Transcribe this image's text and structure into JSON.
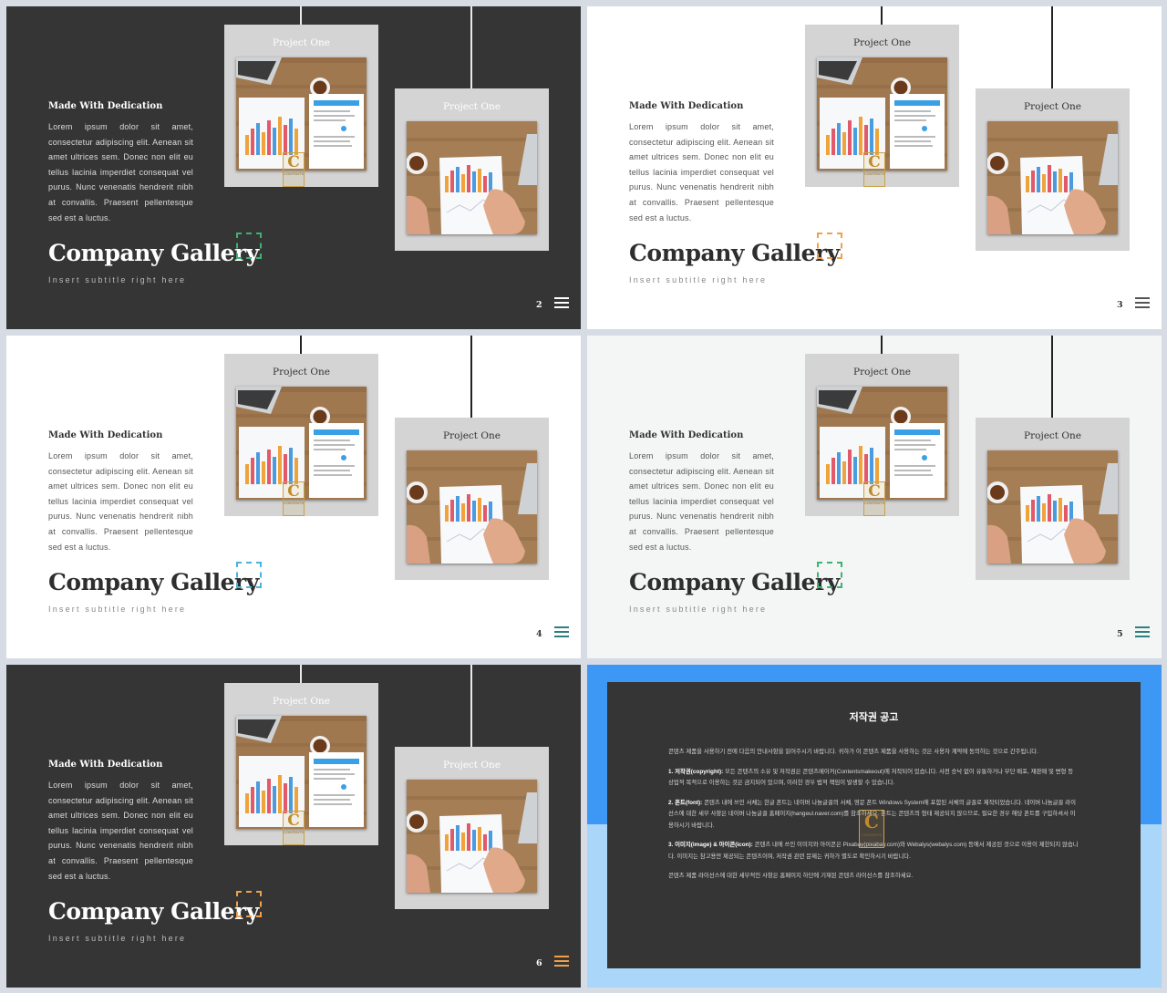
{
  "slides": [
    {
      "number": "2",
      "theme": "dark",
      "background": "#353535",
      "accent": "#3cb371",
      "menu_color": "#ffffff",
      "card_title_color": "#ffffff"
    },
    {
      "number": "3",
      "theme": "light",
      "background": "#ffffff",
      "accent": "#f0a04b",
      "menu_color": "#555555",
      "card_title_color": "#333333"
    },
    {
      "number": "4",
      "theme": "light",
      "background": "#ffffff",
      "accent": "#4ab3d9",
      "menu_color": "#2e7f7f",
      "card_title_color": "#333333"
    },
    {
      "number": "5",
      "theme": "light",
      "background": "#f4f6f5",
      "accent": "#3cb371",
      "menu_color": "#2e7f7f",
      "card_title_color": "#333333"
    },
    {
      "number": "6",
      "theme": "dark",
      "background": "#353535",
      "accent": "#f0a04b",
      "menu_color": "#f0a04b",
      "card_title_color": "#ffffff"
    }
  ],
  "content": {
    "card_title": "Project One",
    "heading": "Made With Dedication",
    "body": "Lorem ipsum dolor sit amet, consectetur adipiscing elit. Aenean sit amet ultrices sem. Donec non elit eu tellus lacinia imperdiet consequat vel purus. Nunc venenatis hendrerit nibh at convallis. Praesent pellentesque sed est a luctus.",
    "title": "Company Gallery",
    "subtitle": "Insert subtitle right here",
    "logo_letter": "C",
    "logo_text": "CONTENTS"
  },
  "notice": {
    "title": "저작권 공고",
    "intro": "콘텐츠 제품을 사용하기 전에 다음의 안내사항을 읽어주시기 바랍니다. 귀하가 이 콘텐츠 제품을 사용하는 것은 사용자 계약에 동의하는 것으로 간주됩니다.",
    "copyright_label": "1. 저작권(copyright):",
    "copyright_text": "모든 콘텐츠의 소유 및 저작권은 콘텐츠메이커(Contentsmakeout)에 저작되어 있습니다. 사전 승낙 없이 유통하거나 무단 배포, 재판매 및 변형 등 상업적 목적으로 이용하는 것은 금지되어 있으며, 이러한 경우 법적 책임이 발생할 수 있습니다.",
    "font_label": "2. 폰트(font):",
    "font_text": "콘텐츠 내에 쓰인 서체는 한글 폰트는 네이버 나눔글꼴의 서체, 영문 폰트 Windows System에 포함된 서체의 글꼴로 제작되었습니다. 네이버 나눔글꼴 라이선스에 대한 세부 사항은 네이버 나눔글꼴 홈페이지(hangeul.naver.com)를 참조하세요. 폰트는 콘텐츠의 형태 제공되지 않으므로, 필요한 경우 해당 폰트를 구입하셔서 이용하시기 바랍니다.",
    "image_label": "3. 이미지(image) & 아이콘(icon):",
    "image_text": "콘텐츠 내에 쓰인 이미지와 아이콘은 Pixabay(pixabay.com)와 Webalys(webalys.com) 등에서 제공된 것으로 이용이 제한되지 않습니다. 이미지는 참고용만 제공되는 콘텐츠이며, 저작권 관련 문제는 귀하가 별도로 확인하시기 바랍니다.",
    "outro": "콘텐츠 제품 라이선스에 대한 세부적인 사항은 홈페이지 하단에 기재된 콘텐츠 라이선스를 참조하세요."
  }
}
